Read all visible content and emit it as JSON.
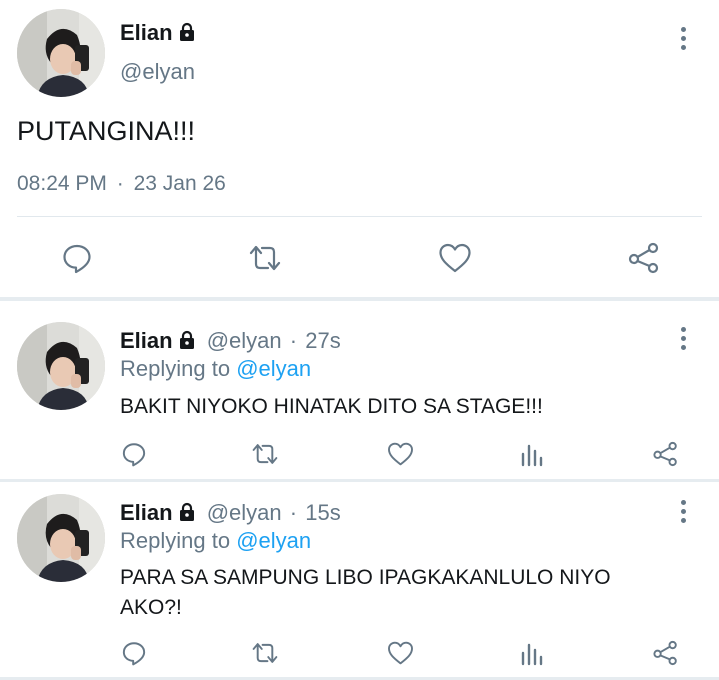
{
  "main_tweet": {
    "name": "Elian",
    "handle": "@elyan",
    "text": "PUTANGINA!!!",
    "time": "08:24 PM",
    "dot": "·",
    "date": "23 Jan 26"
  },
  "replies": [
    {
      "name": "Elian",
      "handle": "@elyan",
      "dot": "·",
      "age": "27s",
      "replying_prefix": "Replying to",
      "replying_handle": "@elyan",
      "text_lines": [
        "BAKIT NIYOKO HINATAK DITO SA STAGE!!!"
      ]
    },
    {
      "name": "Elian",
      "handle": "@elyan",
      "dot": "·",
      "age": "15s",
      "replying_prefix": "Replying to",
      "replying_handle": "@elyan",
      "text_lines": [
        "PARA SA SAMPUNG LIBO IPAGKAKANLULO NIYO",
        "AKO?!"
      ]
    }
  ],
  "colors": {
    "text": "#14171a",
    "secondary": "#657786",
    "link": "#1da1f2",
    "divider": "#e1e8ed"
  },
  "icons": [
    "lock-icon",
    "more-icon",
    "reply-icon",
    "retweet-icon",
    "like-icon",
    "share-icon",
    "analytics-icon",
    "avatar"
  ]
}
